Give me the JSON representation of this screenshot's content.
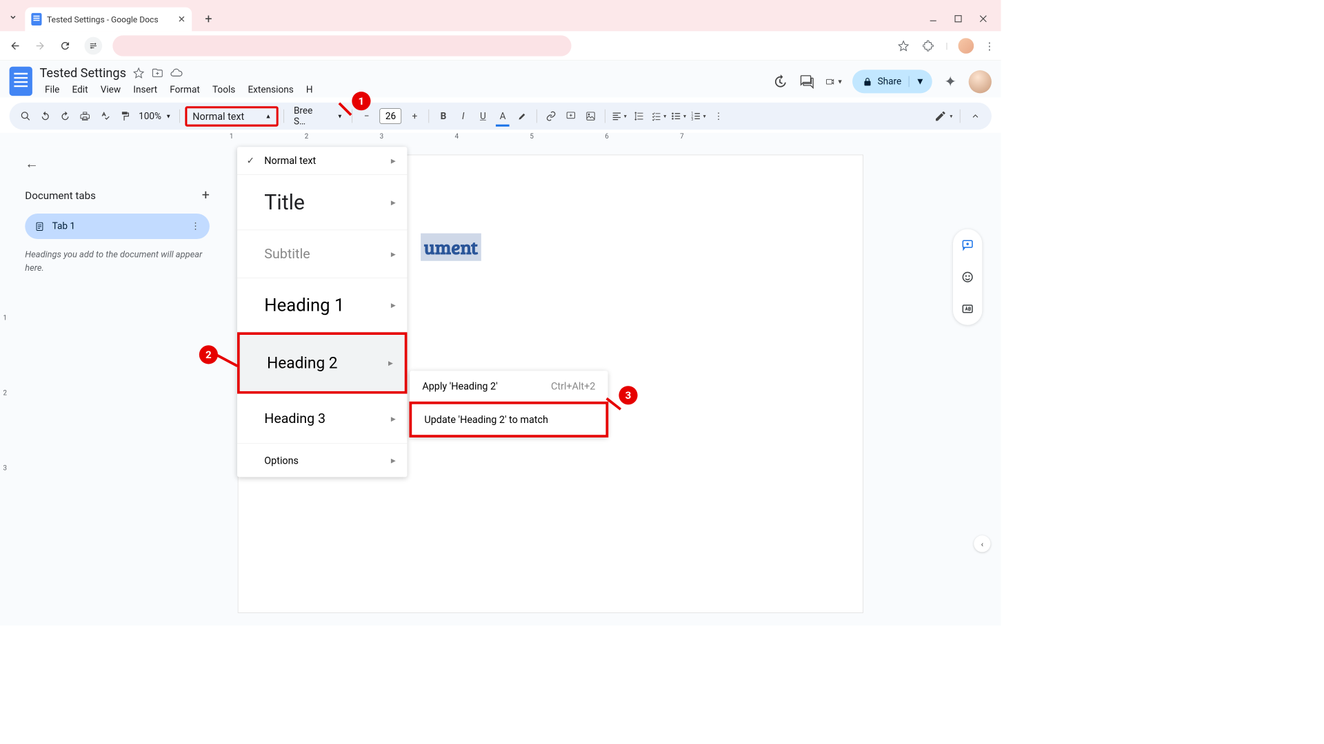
{
  "browser": {
    "tab_title": "Tested Settings - Google Docs"
  },
  "docs": {
    "title": "Tested Settings",
    "menus": [
      "File",
      "Edit",
      "View",
      "Insert",
      "Format",
      "Tools",
      "Extensions",
      "H"
    ],
    "share": "Share"
  },
  "toolbar": {
    "zoom": "100%",
    "style": "Normal text",
    "font": "Bree S…",
    "font_size": "26"
  },
  "sidebar": {
    "title": "Document tabs",
    "tab1": "Tab 1",
    "hint": "Headings you add to the document will appear here."
  },
  "document": {
    "selected_fragment": "ument"
  },
  "style_menu": {
    "normal": "Normal text",
    "title": "Title",
    "subtitle": "Subtitle",
    "h1": "Heading 1",
    "h2": "Heading 2",
    "h3": "Heading 3",
    "options": "Options"
  },
  "submenu": {
    "apply": "Apply 'Heading 2'",
    "apply_shortcut": "Ctrl+Alt+2",
    "update": "Update 'Heading 2' to match"
  },
  "ruler": {
    "n1": "1",
    "n2": "2",
    "n3": "3",
    "n4": "4",
    "n5": "5",
    "n6": "6",
    "n7": "7"
  },
  "vruler": {
    "n1": "1",
    "n2": "2",
    "n3": "3"
  },
  "callouts": {
    "c1": "1",
    "c2": "2",
    "c3": "3"
  }
}
